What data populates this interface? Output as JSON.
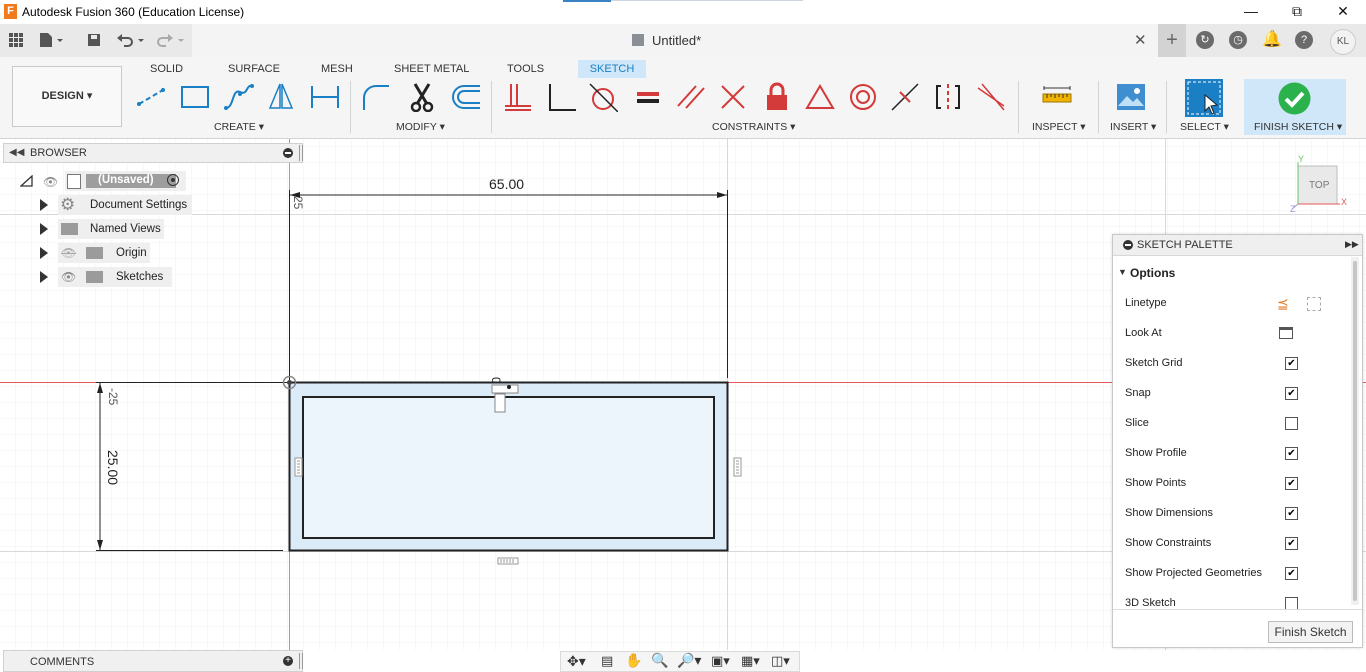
{
  "window": {
    "title": "Autodesk Fusion 360 (Education License)",
    "logo": "F"
  },
  "quickbar": {
    "document_title": "Untitled*",
    "user_initials": "KL"
  },
  "toolbar": {
    "workspace": "DESIGN",
    "tabs": [
      "SOLID",
      "SURFACE",
      "MESH",
      "SHEET METAL",
      "TOOLS",
      "SKETCH"
    ],
    "active_tab": "SKETCH",
    "groups": {
      "create": "CREATE",
      "modify": "MODIFY",
      "constraints": "CONSTRAINTS",
      "inspect": "INSPECT",
      "insert": "INSERT",
      "select": "SELECT",
      "finish": "FINISH SKETCH"
    }
  },
  "browser": {
    "title": "BROWSER",
    "root": "(Unsaved)",
    "items": [
      "Document Settings",
      "Named Views",
      "Origin",
      "Sketches"
    ]
  },
  "sketch": {
    "dim_width": "65.00",
    "dim_height": "25.00",
    "dim_small_top": "25",
    "dim_small_left": "-25",
    "dim_zero": "0"
  },
  "viewcube": {
    "face": "TOP",
    "axis_x": "X",
    "axis_y": "Y",
    "axis_z": "Z"
  },
  "palette": {
    "title": "SKETCH PALETTE",
    "section": "Options",
    "rows": [
      {
        "label": "Linetype",
        "type": "icons"
      },
      {
        "label": "Look At",
        "type": "icon"
      },
      {
        "label": "Sketch Grid",
        "type": "checkbox",
        "checked": true
      },
      {
        "label": "Snap",
        "type": "checkbox",
        "checked": true
      },
      {
        "label": "Slice",
        "type": "checkbox",
        "checked": false
      },
      {
        "label": "Show Profile",
        "type": "checkbox",
        "checked": true
      },
      {
        "label": "Show Points",
        "type": "checkbox",
        "checked": true
      },
      {
        "label": "Show Dimensions",
        "type": "checkbox",
        "checked": true
      },
      {
        "label": "Show Constraints",
        "type": "checkbox",
        "checked": true
      },
      {
        "label": "Show Projected Geometries",
        "type": "checkbox",
        "checked": true
      },
      {
        "label": "3D Sketch",
        "type": "checkbox",
        "checked": false
      }
    ],
    "finish_button": "Finish Sketch"
  },
  "comments": {
    "title": "COMMENTS"
  },
  "colors": {
    "accent": "#1a7fc4",
    "tab_active_bg": "#cfe7f8",
    "finish_green": "#2bb24c",
    "constraint_red": "#d33a3a",
    "x_axis": "#e45a5a",
    "y_axis": "#64c864"
  }
}
